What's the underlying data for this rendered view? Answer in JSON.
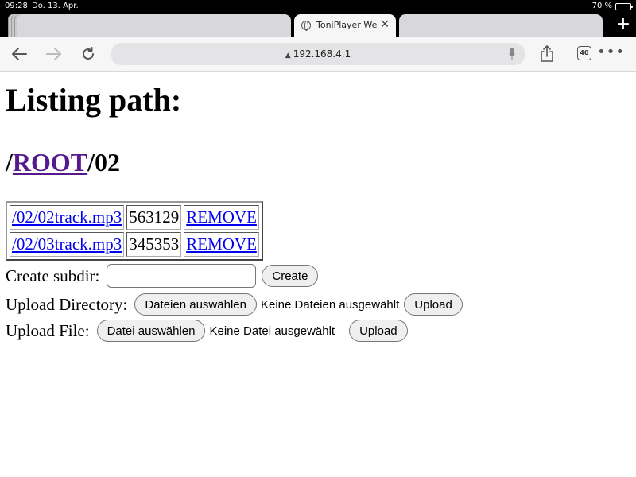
{
  "status_bar": {
    "time": "09:28",
    "date": "Do. 13. Apr.",
    "battery": "70 %",
    "battery_level": 0.7
  },
  "tabs": [
    {
      "title": "",
      "active": false
    },
    {
      "title": "ToniPlayer Web",
      "active": true
    },
    {
      "title": "",
      "active": false
    }
  ],
  "new_tab_label": "+",
  "toolbar": {
    "url": "192.168.4.1",
    "tab_count": "40"
  },
  "page": {
    "heading": "Listing path:",
    "path_prefix": "/",
    "root_link": "ROOT",
    "path_suffix": "/02",
    "files": [
      {
        "name": "/02/02track.mp3",
        "size": "563129",
        "action": "REMOVE"
      },
      {
        "name": "/02/03track.mp3",
        "size": "345353",
        "action": "REMOVE"
      }
    ],
    "create_subdir": {
      "label": "Create subdir:",
      "value": "",
      "button": "Create"
    },
    "upload_directory": {
      "label": "Upload Directory:",
      "choose_button": "Dateien auswählen",
      "status": "Keine Dateien ausgewählt",
      "upload_button": "Upload"
    },
    "upload_file": {
      "label": "Upload File:",
      "choose_button": "Datei auswählen",
      "status": "Keine Datei ausgewählt",
      "upload_button": "Upload"
    }
  }
}
